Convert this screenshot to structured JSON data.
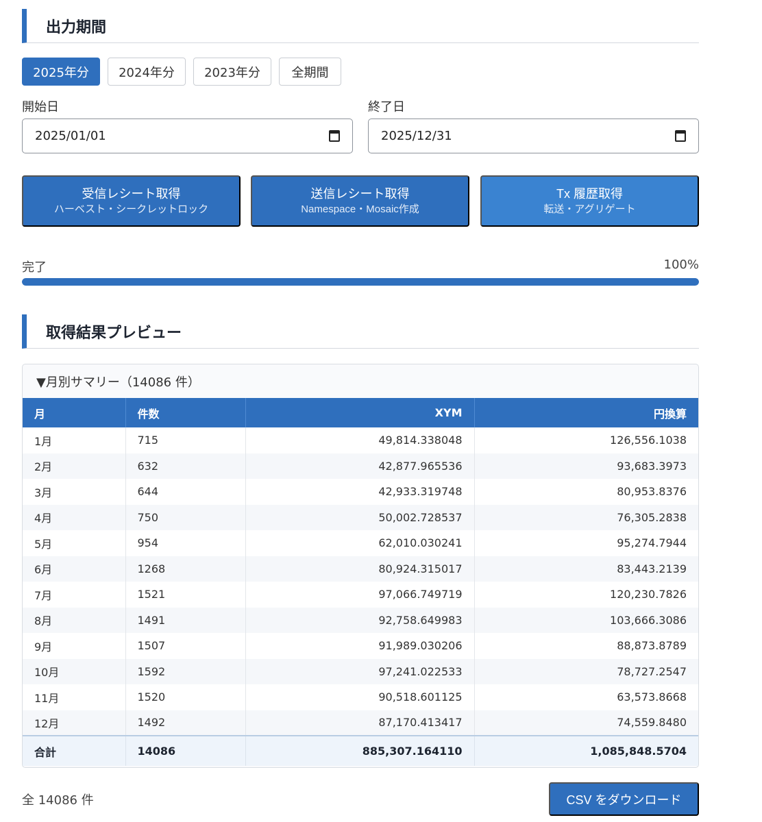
{
  "output_period": {
    "title": "出力期間",
    "buttons": [
      {
        "label": "2025年分",
        "active": true
      },
      {
        "label": "2024年分",
        "active": false
      },
      {
        "label": "2023年分",
        "active": false
      },
      {
        "label": "全期間",
        "active": false
      }
    ],
    "start_label": "開始日",
    "start_value": "2025/01/01",
    "end_label": "終了日",
    "end_value": "2025/12/31"
  },
  "actions": [
    {
      "main": "受信レシート取得",
      "sub": "ハーベスト・シークレットロック"
    },
    {
      "main": "送信レシート取得",
      "sub": "Namespace・Mosaic作成"
    },
    {
      "main": "Tx 履歴取得",
      "sub": "転送・アグリゲート"
    }
  ],
  "progress": {
    "label": "完了",
    "percent_text": "100%",
    "value": 100
  },
  "preview": {
    "title": "取得結果プレビュー",
    "summary_toggle": "▼月別サマリー（14086 件）",
    "columns": [
      "月",
      "件数",
      "XYM",
      "円換算"
    ],
    "rows": [
      [
        "1月",
        "715",
        "49,814.338048",
        "126,556.1038"
      ],
      [
        "2月",
        "632",
        "42,877.965536",
        "93,683.3973"
      ],
      [
        "3月",
        "644",
        "42,933.319748",
        "80,953.8376"
      ],
      [
        "4月",
        "750",
        "50,002.728537",
        "76,305.2838"
      ],
      [
        "5月",
        "954",
        "62,010.030241",
        "95,274.7944"
      ],
      [
        "6月",
        "1268",
        "80,924.315017",
        "83,443.2139"
      ],
      [
        "7月",
        "1521",
        "97,066.749719",
        "120,230.7826"
      ],
      [
        "8月",
        "1491",
        "92,758.649983",
        "103,666.3086"
      ],
      [
        "9月",
        "1507",
        "91,989.030206",
        "88,873.8789"
      ],
      [
        "10月",
        "1592",
        "97,241.022533",
        "78,727.2547"
      ],
      [
        "11月",
        "1520",
        "90,518.601125",
        "63,573.8668"
      ],
      [
        "12月",
        "1492",
        "87,170.413417",
        "74,559.8480"
      ]
    ],
    "total": [
      "合計",
      "14086",
      "885,307.164110",
      "1,085,848.5704"
    ]
  },
  "footer": {
    "total_count": "全 14086 件",
    "csv_button": "CSV をダウンロード"
  },
  "colors": {
    "accent": "#2f6fbd"
  }
}
